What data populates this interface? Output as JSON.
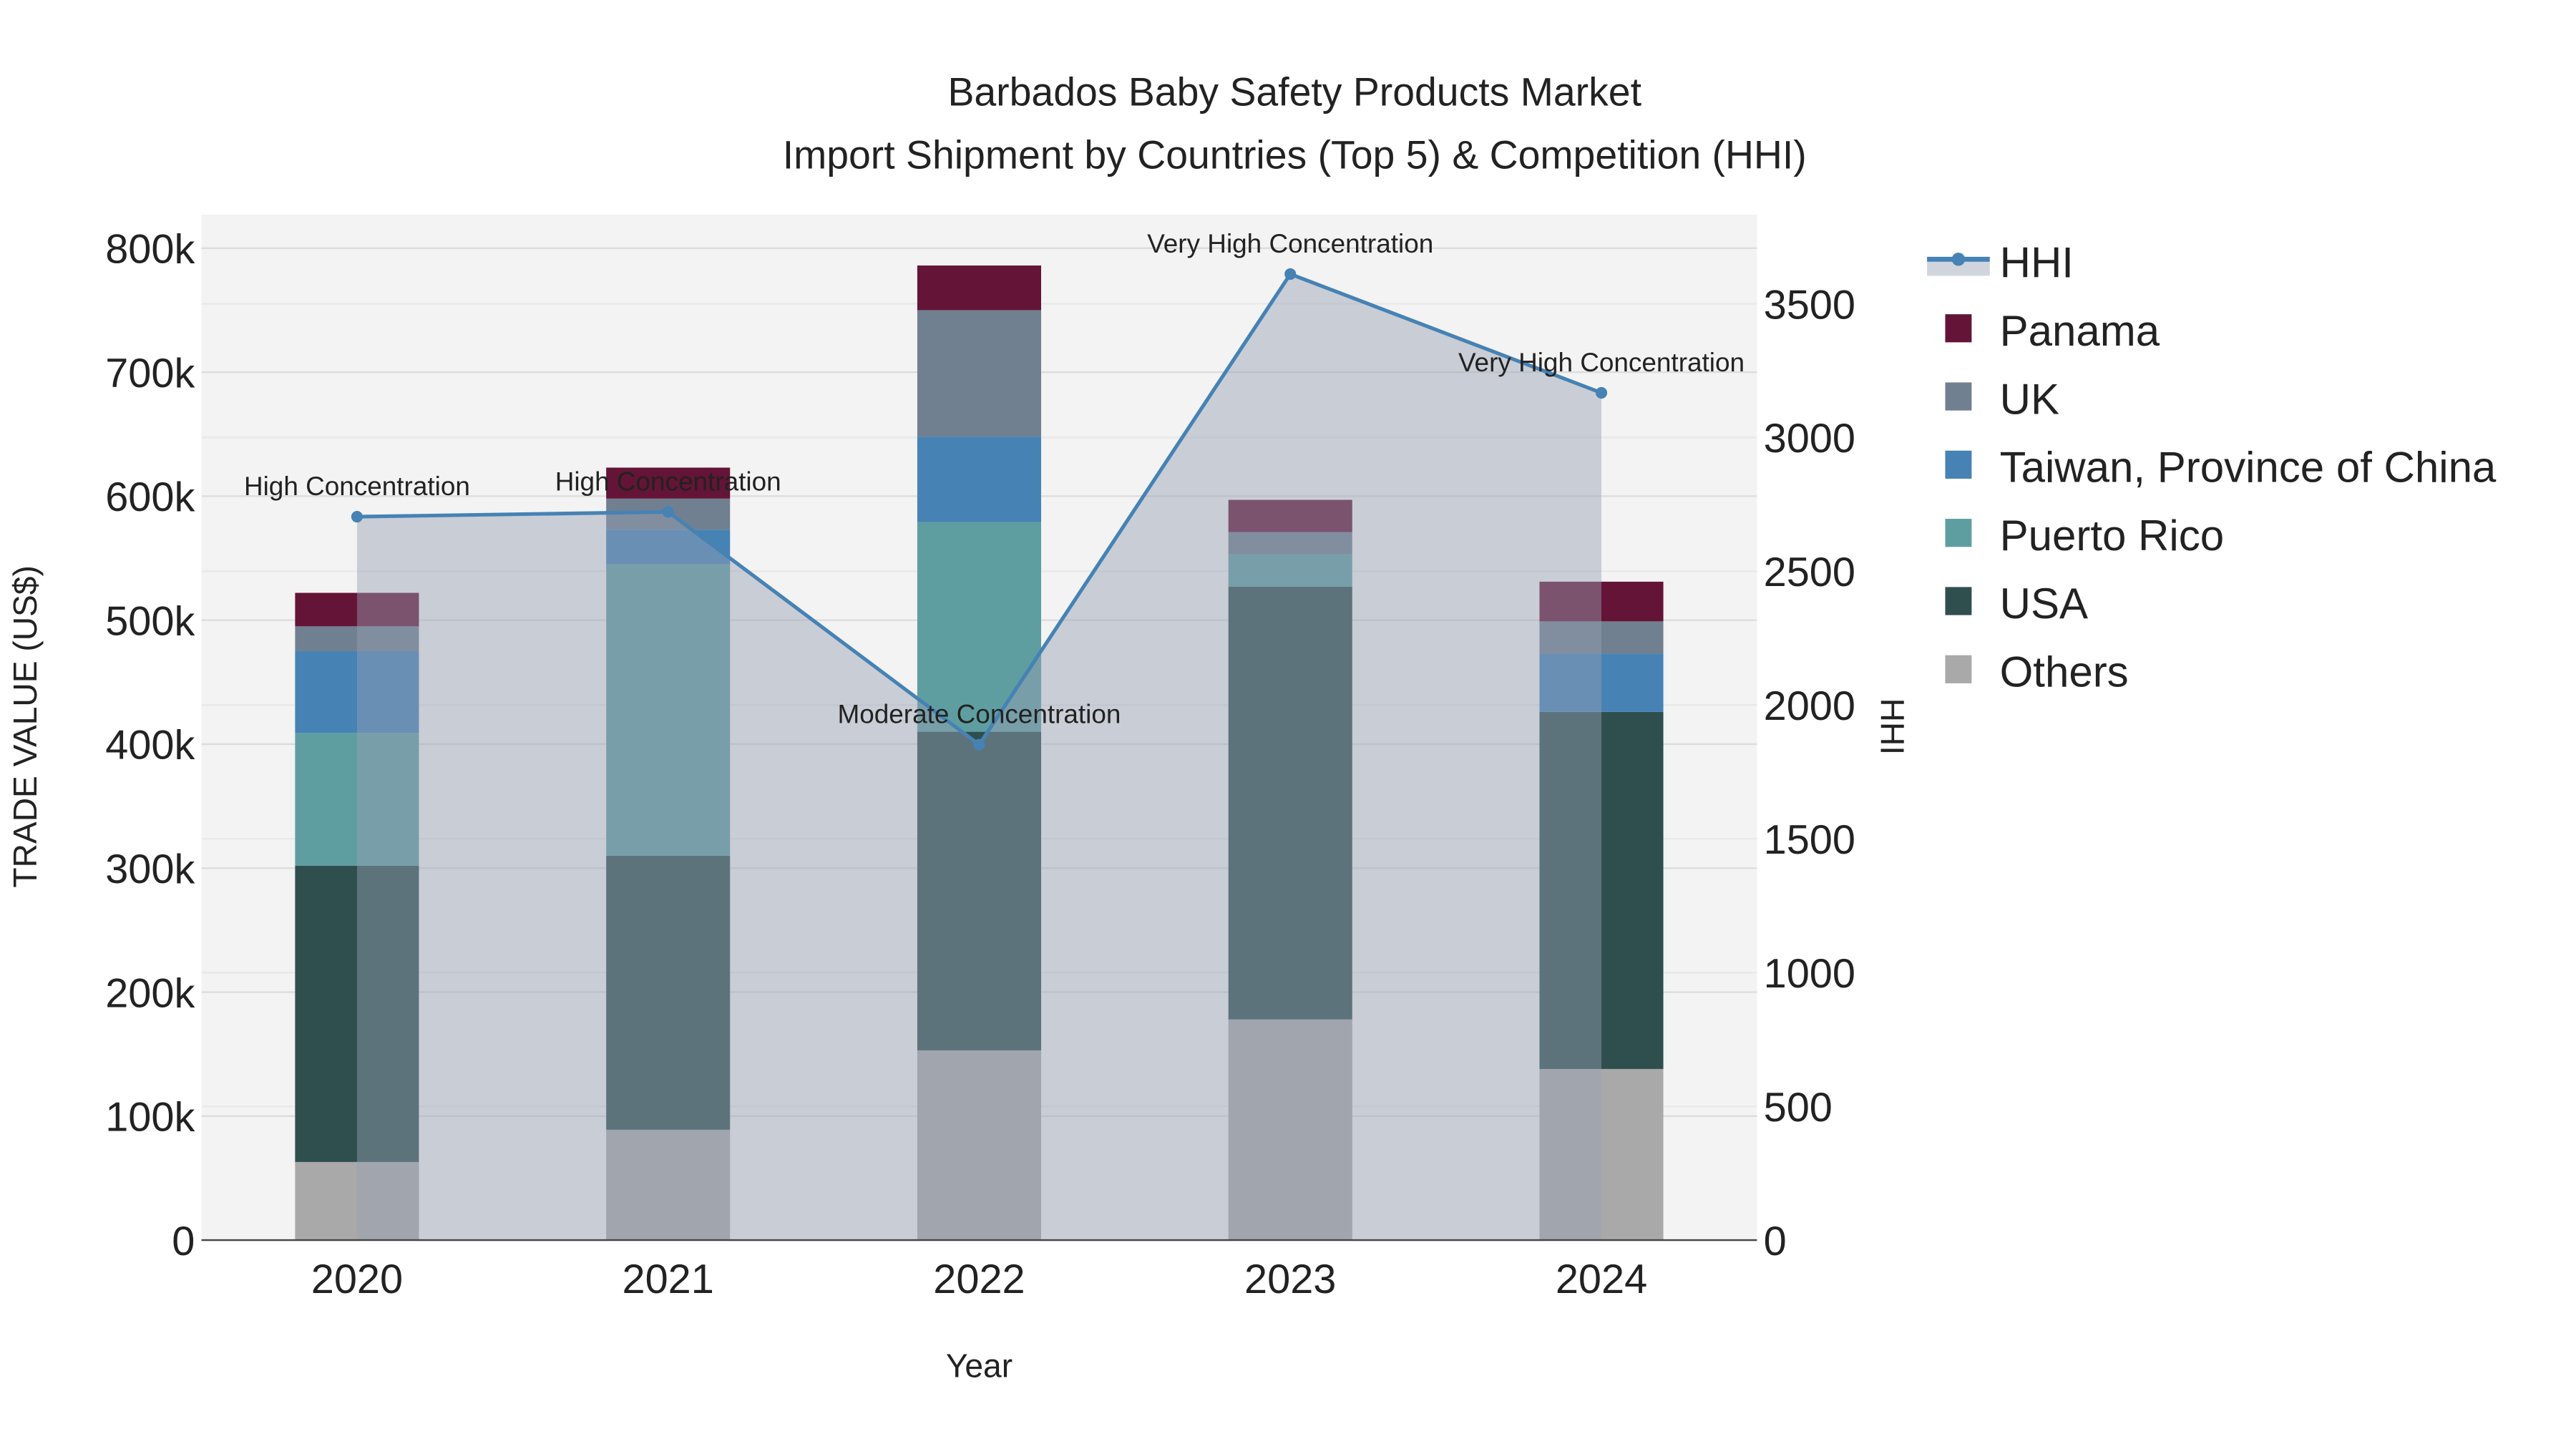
{
  "chart_data": {
    "type": "bar",
    "stacked": true,
    "title": "Barbados Baby Safety Products Market",
    "subtitle": "Import Shipment by Countries (Top 5) & Competition (HHI)",
    "xlabel": "Year",
    "ylabel": "TRADE VALUE (US$)",
    "y2label": "HHI",
    "categories": [
      "2020",
      "2021",
      "2022",
      "2023",
      "2024"
    ],
    "ylim": [
      0,
      827000
    ],
    "y_ticks": [
      0,
      100000,
      200000,
      300000,
      400000,
      500000,
      600000,
      700000,
      800000
    ],
    "y_tick_labels": [
      "0",
      "100k",
      "200k",
      "300k",
      "400k",
      "500k",
      "600k",
      "700k",
      "800k"
    ],
    "y2lim": [
      0,
      3833
    ],
    "y2_ticks": [
      0,
      500,
      1000,
      1500,
      2000,
      2500,
      3000,
      3500
    ],
    "y2_tick_labels": [
      "0",
      "500",
      "1000",
      "1500",
      "2000",
      "2500",
      "3000",
      "3500"
    ],
    "grid": true,
    "legend_placement": "right",
    "series": [
      {
        "name": "Others",
        "color": "#a9a9a9",
        "values": [
          63000,
          89000,
          153000,
          178000,
          138000
        ]
      },
      {
        "name": "USA",
        "color": "#2f4f4f",
        "values": [
          239000,
          221000,
          257000,
          349000,
          288000
        ]
      },
      {
        "name": "Puerto Rico",
        "color": "#5f9ea0",
        "values": [
          107000,
          235000,
          169000,
          26000,
          0
        ]
      },
      {
        "name": "Taiwan, Province of China",
        "color": "#4682b4",
        "values": [
          66000,
          28000,
          69000,
          0,
          47000
        ]
      },
      {
        "name": "UK",
        "color": "#708090",
        "values": [
          20000,
          25000,
          102000,
          18000,
          26000
        ]
      },
      {
        "name": "Panama",
        "color": "#641436",
        "values": [
          27000,
          25000,
          36000,
          26000,
          32000
        ]
      }
    ],
    "hhi": {
      "name": "HHI",
      "color": "#4682b4",
      "values": [
        2704,
        2722,
        1852,
        3611,
        3167
      ],
      "annotations": [
        "High Concentration",
        "High Concentration",
        "Moderate Concentration",
        "Very High Concentration",
        "Very High Concentration"
      ]
    },
    "legend": [
      "HHI",
      "Panama",
      "UK",
      "Taiwan, Province of China",
      "Puerto Rico",
      "USA",
      "Others"
    ]
  }
}
